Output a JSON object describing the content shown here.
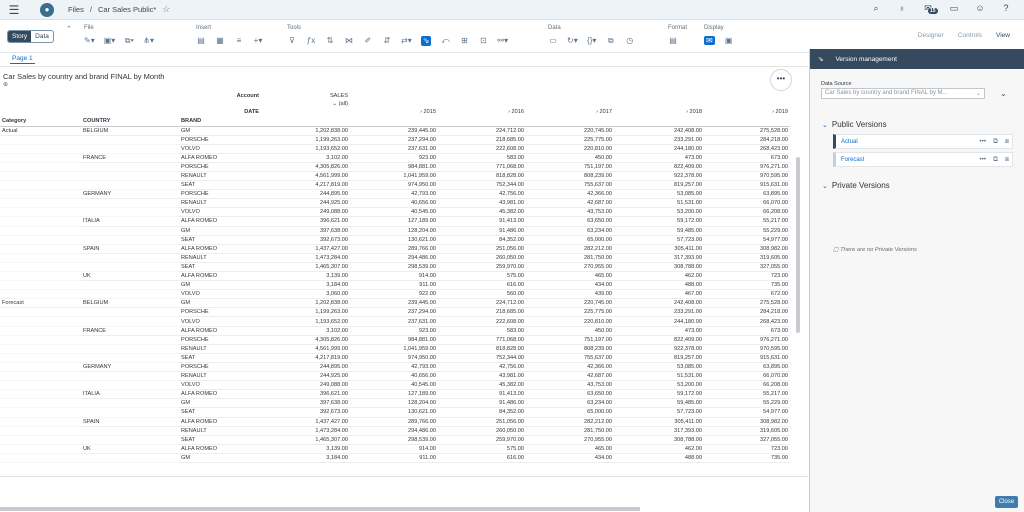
{
  "shell": {
    "breadcrumb": [
      "Files",
      "/",
      "Car Sales Public*"
    ],
    "icons": [
      "menu-icon",
      "home-icon",
      "star-icon",
      "search-icon",
      "lightbulb-icon",
      "notification-icon",
      "chat-icon",
      "feedback-icon",
      "help-icon"
    ],
    "notification_count": "15"
  },
  "toolbar": {
    "mode_story": "Story",
    "mode_data": "Data",
    "groups": [
      {
        "label": "File"
      },
      {
        "label": "Insert"
      },
      {
        "label": "Tools"
      },
      {
        "label": "Data"
      },
      {
        "label": "Format"
      },
      {
        "label": "Display"
      }
    ],
    "right_tabs": [
      "Designer",
      "Controls",
      "View"
    ]
  },
  "page_tab": "Page 1",
  "tile": {
    "title": "Car Sales by country and brand FINAL by Month",
    "subtitle": "⊕",
    "more": "•••"
  },
  "grid": {
    "dim_account": "Account",
    "dim_date": "DATE",
    "measure": "SALES",
    "all_label": "(all)",
    "years": [
      "2015",
      "2016",
      "2017",
      "2018",
      "2019"
    ],
    "col_headers": [
      "Category",
      "COUNTRY",
      "BRAND"
    ],
    "rows": [
      [
        "Actual",
        "BELGIUM",
        "GM",
        "1,202,838.00",
        "239,445.00",
        "224,712.00",
        "220,745.00",
        "242,408.00",
        "275,528.00"
      ],
      [
        "",
        "",
        "PORSCHE",
        "1,199,263.00",
        "237,294.00",
        "218,685.00",
        "225,775.00",
        "233,291.00",
        "284,218.00"
      ],
      [
        "",
        "",
        "VOLVO",
        "1,193,652.00",
        "237,631.00",
        "222,608.00",
        "220,810.00",
        "244,180.00",
        "268,423.00"
      ],
      [
        "",
        "FRANCE",
        "ALFA ROMEO",
        "3,102.00",
        "923.00",
        "583.00",
        "450.00",
        "473.00",
        "673.00"
      ],
      [
        "",
        "",
        "PORSCHE",
        "4,305,826.00",
        "984,881.00",
        "771,068.00",
        "751,197.00",
        "822,409.00",
        "976,271.00"
      ],
      [
        "",
        "",
        "RENAULT",
        "4,561,999.00",
        "1,041,959.00",
        "818,828.00",
        "808,239.00",
        "922,378.00",
        "970,595.00"
      ],
      [
        "",
        "",
        "SEAT",
        "4,217,819.00",
        "974,950.00",
        "752,344.00",
        "755,637.00",
        "819,257.00",
        "915,631.00"
      ],
      [
        "",
        "GERMANY",
        "PORSCHE",
        "244,895.00",
        "42,793.00",
        "42,756.00",
        "42,366.00",
        "53,085.00",
        "63,895.00"
      ],
      [
        "",
        "",
        "RENAULT",
        "244,925.00",
        "40,656.00",
        "43,981.00",
        "42,687.00",
        "51,531.00",
        "66,070.00"
      ],
      [
        "",
        "",
        "VOLVO",
        "249,088.00",
        "40,545.00",
        "45,382.00",
        "43,753.00",
        "53,200.00",
        "66,208.00"
      ],
      [
        "",
        "ITALIA",
        "ALFA ROMEO",
        "396,621.00",
        "127,189.00",
        "91,413.00",
        "63,650.00",
        "59,172.00",
        "55,217.00"
      ],
      [
        "",
        "",
        "GM",
        "397,638.00",
        "128,204.00",
        "91,486.00",
        "63,234.00",
        "59,485.00",
        "55,229.00"
      ],
      [
        "",
        "",
        "SEAT",
        "392,673.00",
        "130,621.00",
        "84,352.00",
        "65,000.00",
        "57,723.00",
        "54,977.00"
      ],
      [
        "",
        "SPAIN",
        "ALFA ROMEO",
        "1,437,427.00",
        "289,766.00",
        "251,056.00",
        "282,212.00",
        "305,411.00",
        "308,982.00"
      ],
      [
        "",
        "",
        "RENAULT",
        "1,473,284.00",
        "294,486.00",
        "260,050.00",
        "281,750.00",
        "317,393.00",
        "319,605.00"
      ],
      [
        "",
        "",
        "SEAT",
        "1,465,307.00",
        "298,539.00",
        "259,970.00",
        "270,955.00",
        "308,788.00",
        "327,055.00"
      ],
      [
        "",
        "UK",
        "ALFA ROMEO",
        "3,139.00",
        "914.00",
        "575.00",
        "465.00",
        "462.00",
        "723.00"
      ],
      [
        "",
        "",
        "GM",
        "3,184.00",
        "911.00",
        "616.00",
        "434.00",
        "488.00",
        "735.00"
      ],
      [
        "",
        "",
        "VOLVO",
        "3,060.00",
        "922.00",
        "560.00",
        "439.00",
        "467.00",
        "672.00"
      ],
      [
        "Forecast",
        "BELGIUM",
        "GM",
        "1,202,838.00",
        "239,445.00",
        "224,712.00",
        "220,745.00",
        "242,408.00",
        "275,528.00"
      ],
      [
        "",
        "",
        "PORSCHE",
        "1,199,263.00",
        "237,294.00",
        "218,685.00",
        "225,775.00",
        "233,291.00",
        "284,218.00"
      ],
      [
        "",
        "",
        "VOLVO",
        "1,193,652.00",
        "237,631.00",
        "222,608.00",
        "220,810.00",
        "244,180.00",
        "268,423.00"
      ],
      [
        "",
        "FRANCE",
        "ALFA ROMEO",
        "3,102.00",
        "923.00",
        "583.00",
        "450.00",
        "473.00",
        "673.00"
      ],
      [
        "",
        "",
        "PORSCHE",
        "4,305,826.00",
        "984,881.00",
        "771,068.00",
        "751,197.00",
        "822,409.00",
        "976,271.00"
      ],
      [
        "",
        "",
        "RENAULT",
        "4,561,999.00",
        "1,041,959.00",
        "818,828.00",
        "808,239.00",
        "922,378.00",
        "970,595.00"
      ],
      [
        "",
        "",
        "SEAT",
        "4,217,819.00",
        "974,950.00",
        "752,344.00",
        "755,637.00",
        "819,257.00",
        "915,631.00"
      ],
      [
        "",
        "GERMANY",
        "PORSCHE",
        "244,895.00",
        "42,793.00",
        "42,756.00",
        "42,366.00",
        "53,085.00",
        "63,895.00"
      ],
      [
        "",
        "",
        "RENAULT",
        "244,925.00",
        "40,656.00",
        "43,981.00",
        "42,687.00",
        "51,531.00",
        "66,070.00"
      ],
      [
        "",
        "",
        "VOLVO",
        "249,088.00",
        "40,545.00",
        "45,382.00",
        "43,753.00",
        "53,200.00",
        "66,208.00"
      ],
      [
        "",
        "ITALIA",
        "ALFA ROMEO",
        "396,621.00",
        "127,189.00",
        "91,413.00",
        "63,650.00",
        "59,172.00",
        "55,217.00"
      ],
      [
        "",
        "",
        "GM",
        "397,638.00",
        "128,204.00",
        "91,486.00",
        "63,234.00",
        "59,485.00",
        "55,229.00"
      ],
      [
        "",
        "",
        "SEAT",
        "392,673.00",
        "130,621.00",
        "84,352.00",
        "65,000.00",
        "57,723.00",
        "54,977.00"
      ],
      [
        "",
        "SPAIN",
        "ALFA ROMEO",
        "1,437,427.00",
        "289,766.00",
        "251,056.00",
        "282,212.00",
        "305,411.00",
        "308,982.00"
      ],
      [
        "",
        "",
        "RENAULT",
        "1,473,284.00",
        "294,486.00",
        "260,050.00",
        "281,750.00",
        "317,393.00",
        "319,605.00"
      ],
      [
        "",
        "",
        "SEAT",
        "1,465,307.00",
        "298,539.00",
        "259,970.00",
        "270,955.00",
        "308,788.00",
        "327,055.00"
      ],
      [
        "",
        "UK",
        "ALFA ROMEO",
        "3,139.00",
        "914.00",
        "575.00",
        "465.00",
        "462.00",
        "723.00"
      ],
      [
        "",
        "",
        "GM",
        "3,184.00",
        "911.00",
        "616.00",
        "434.00",
        "488.00",
        "735.00"
      ]
    ]
  },
  "panel": {
    "title": "Version management",
    "datasource_label": "Data Source",
    "datasource_value": "Car Sales by country and brand FINAL by M...",
    "public_title": "Public Versions",
    "public_versions": [
      "Actual",
      "Forecast"
    ],
    "private_title": "Private Versions",
    "no_private": "There are no Private Versions",
    "close": "Close"
  },
  "colors": {
    "shell_bg": "#eef3f8",
    "panel_header": "#354a5f",
    "accent": "#0a6ed1",
    "close_button": "#427cac"
  }
}
